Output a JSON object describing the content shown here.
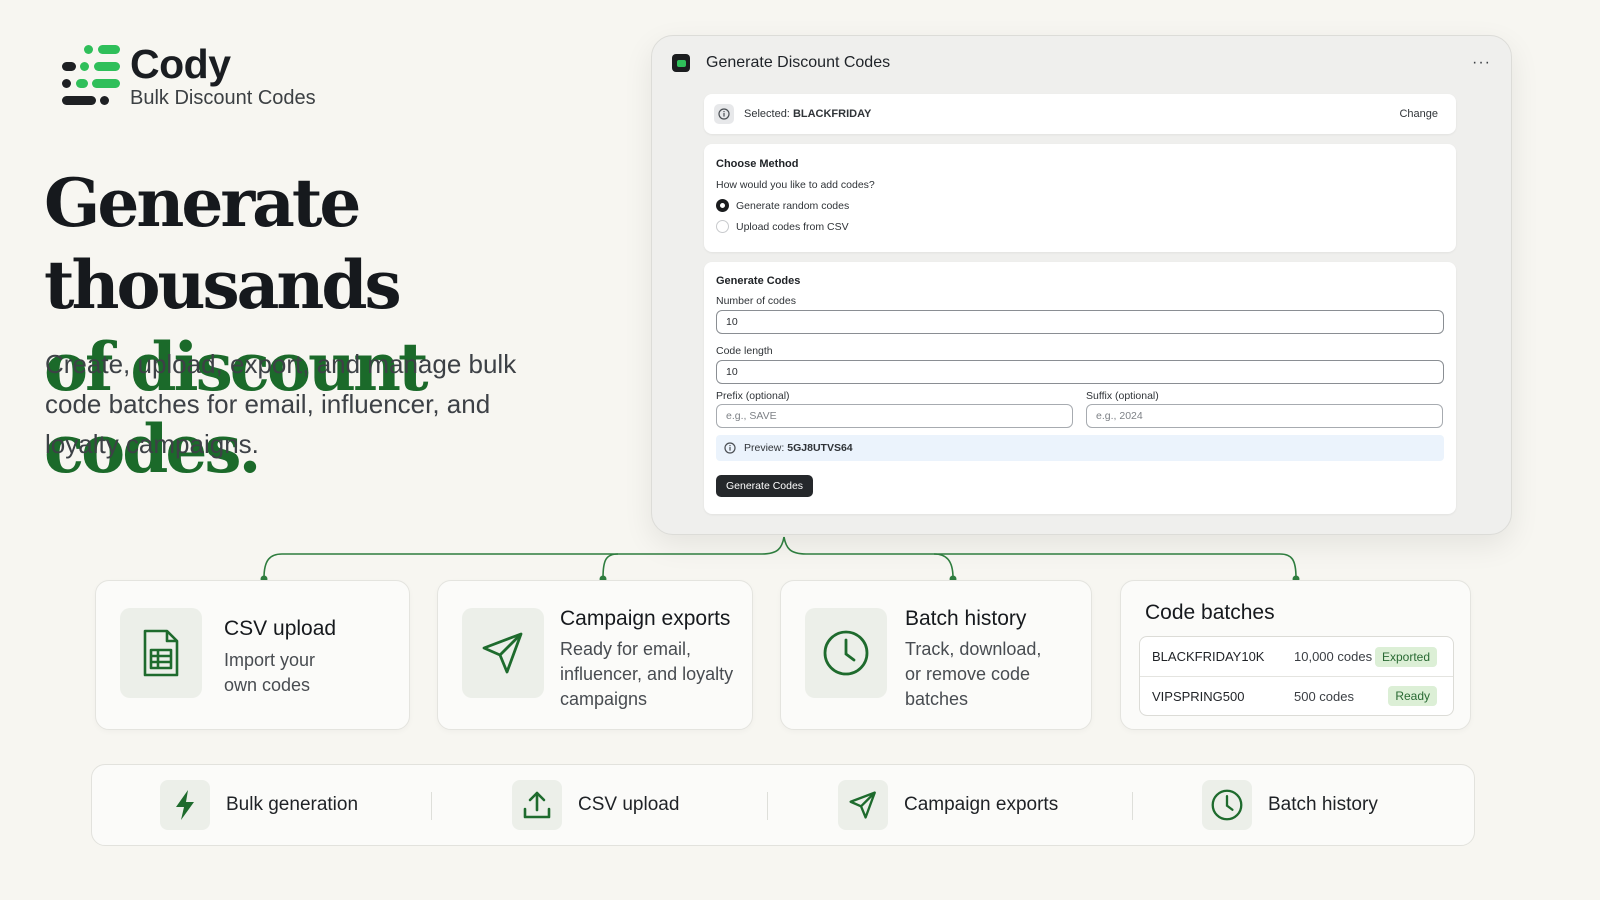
{
  "brand": {
    "name": "Cody",
    "tagline": "Bulk Discount Codes",
    "accent": "#1b6a2a",
    "logo_green": "#2fbf5a"
  },
  "hero": {
    "title_line1": "Generate thousands",
    "title_line2": "of discount codes.",
    "subtitle": "Create, upload, export, and manage bulk code batches for email, influencer, and loyalty campaigns."
  },
  "app": {
    "title": "Generate Discount Codes",
    "more_icon": "ellipsis-icon",
    "selected": {
      "label": "Selected:",
      "value": "BLACKFRIDAY",
      "change": "Change"
    },
    "method": {
      "heading": "Choose Method",
      "question": "How would you like to add codes?",
      "options": [
        {
          "label": "Generate random codes",
          "checked": true
        },
        {
          "label": "Upload codes from CSV",
          "checked": false
        }
      ]
    },
    "generate": {
      "heading": "Generate Codes",
      "number_label": "Number of codes",
      "number_value": "10",
      "length_label": "Code length",
      "length_value": "10",
      "prefix_label": "Prefix (optional)",
      "prefix_placeholder": "e.g., SAVE",
      "suffix_label": "Suffix (optional)",
      "suffix_placeholder": "e.g., 2024",
      "preview_label": "Preview:",
      "preview_value": "5GJ8UTVS64",
      "button": "Generate Codes"
    }
  },
  "features": [
    {
      "title": "CSV upload",
      "desc_lines": [
        "Import your",
        "own codes"
      ],
      "icon": "spreadsheet-file-icon"
    },
    {
      "title": "Campaign exports",
      "desc_lines": [
        "Ready for email,",
        "influencer, and loyalty",
        "campaigns"
      ],
      "icon": "paper-plane-icon"
    },
    {
      "title": "Batch history",
      "desc_lines": [
        "Track, download,",
        "or remove code",
        "batches"
      ],
      "icon": "clock-icon"
    }
  ],
  "batches": {
    "title": "Code batches",
    "rows": [
      {
        "name": "BLACKFRIDAY10K",
        "count": "10,000 codes",
        "status": "Exported"
      },
      {
        "name": "VIPSPRING500",
        "count": "500 codes",
        "status": "Ready"
      }
    ]
  },
  "strip": [
    {
      "label": "Bulk generation",
      "icon": "lightning-bolt-icon"
    },
    {
      "label": "CSV upload",
      "icon": "upload-icon"
    },
    {
      "label": "Campaign exports",
      "icon": "paper-plane-icon"
    },
    {
      "label": "Batch history",
      "icon": "clock-icon"
    }
  ]
}
